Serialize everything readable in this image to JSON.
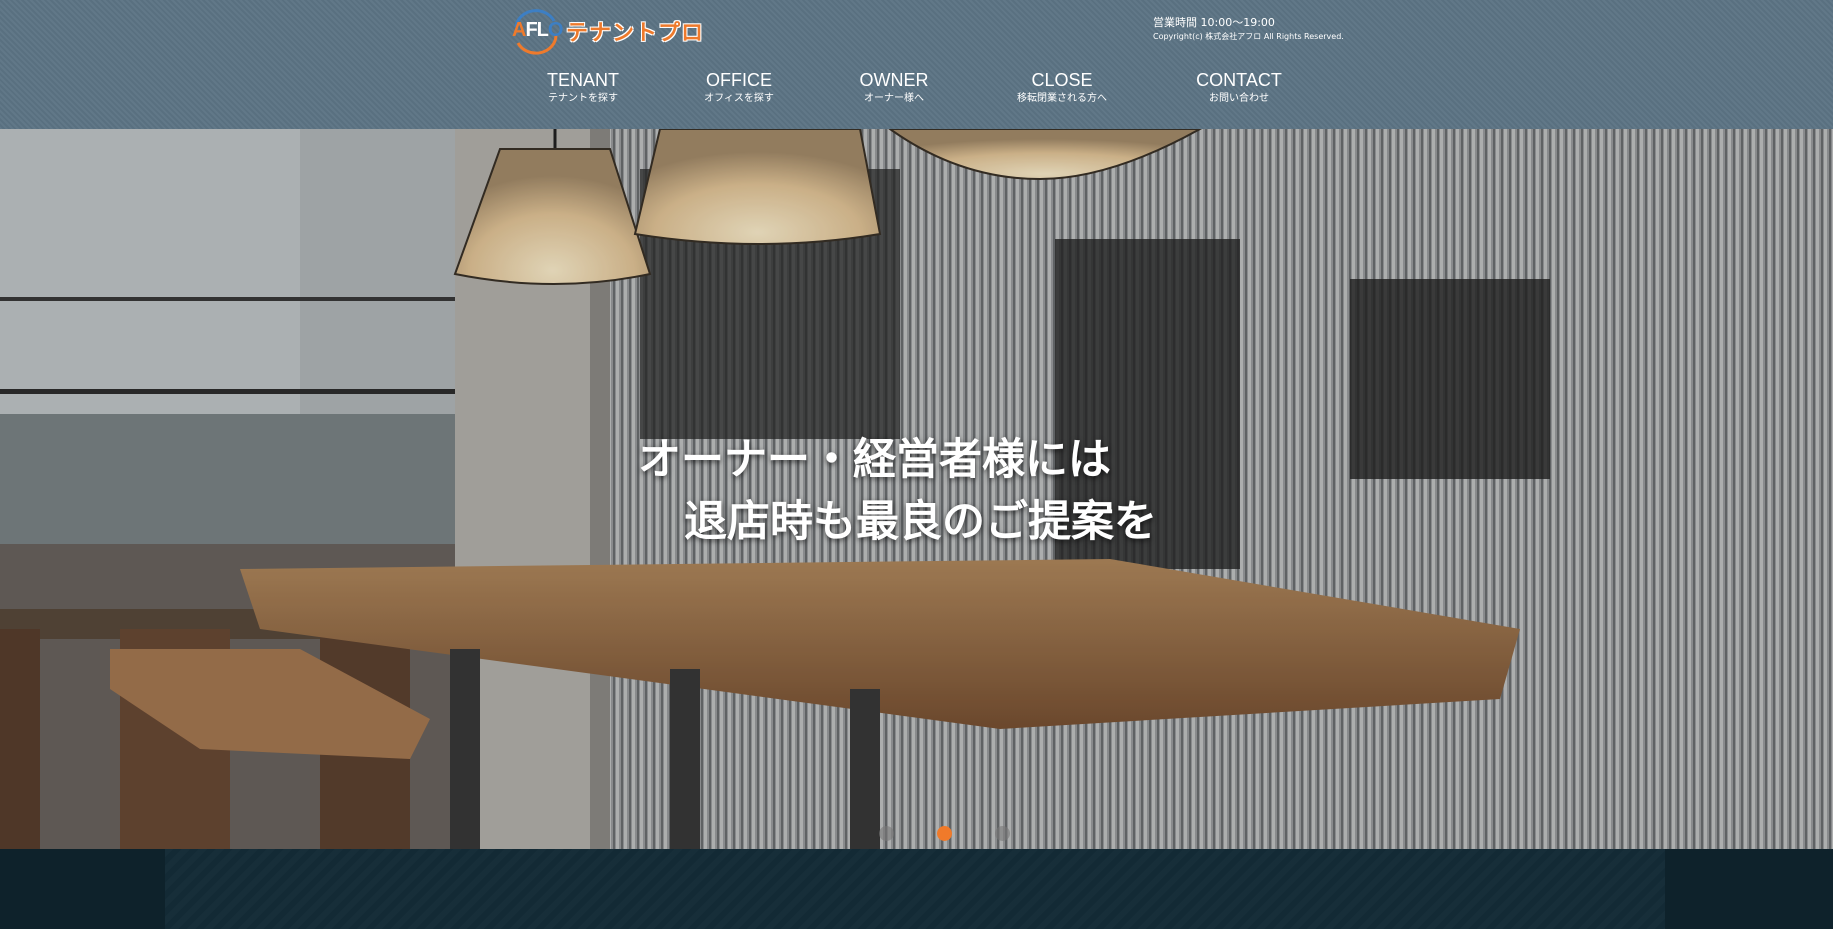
{
  "header": {
    "logo": {
      "mark_text": "AFLO",
      "name": "テナントプロ"
    },
    "hours": "営業時間 10:00〜19:00",
    "copyright": "Copyright(c) 株式会社アフロ All Rights Reserved."
  },
  "nav": {
    "items": [
      {
        "en": "TENANT",
        "ja": "テナントを探す"
      },
      {
        "en": "OFFICE",
        "ja": "オフィスを探す"
      },
      {
        "en": "OWNER",
        "ja": "オーナー様へ"
      },
      {
        "en": "CLOSE",
        "ja": "移転閉業される方へ"
      },
      {
        "en": "CONTACT",
        "ja": "お問い合わせ"
      }
    ]
  },
  "hero": {
    "headline_line1": "オーナー・経営者様には",
    "headline_line2": "退店時も最良のご提案を",
    "slides": {
      "count": 3,
      "active": 2
    }
  },
  "colors": {
    "header_bg": "#5c7484",
    "accent_orange": "#ee7a2c",
    "logo_blue": "#3d7fc4",
    "footer_band": "#0e222b"
  }
}
